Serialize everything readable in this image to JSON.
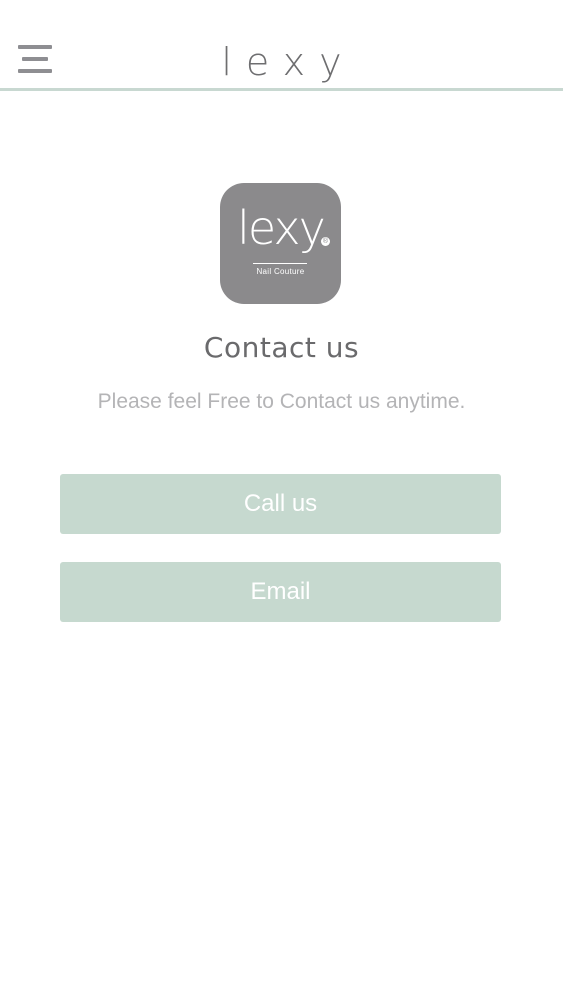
{
  "header": {
    "menu_icon": "hamburger-menu-icon",
    "title": "lexy",
    "accent_line_color": "#c8d8d1"
  },
  "logo": {
    "wordmark": "lexy",
    "registered": "®",
    "tagline": "Nail Couture",
    "tile_color": "#8b8a8c"
  },
  "main": {
    "title": "Contact us",
    "subtitle": "Please feel Free to Contact us anytime.",
    "call_label": "Call us",
    "email_label": "Email",
    "button_color": "#c6d9cf"
  }
}
